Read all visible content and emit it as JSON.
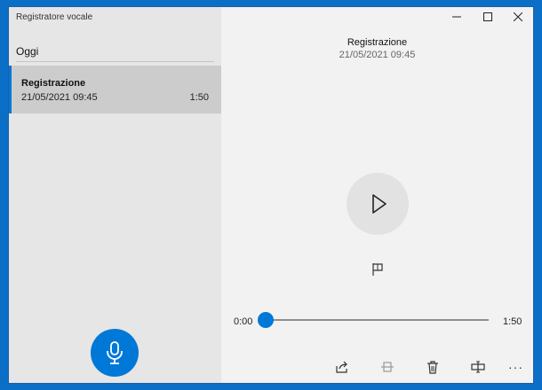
{
  "app": {
    "title": "Registratore vocale"
  },
  "list": {
    "section": "Oggi",
    "items": [
      {
        "name": "Registrazione",
        "date": "21/05/2021 09:45",
        "duration": "1:50"
      }
    ]
  },
  "detail": {
    "title": "Registrazione",
    "date": "21/05/2021 09:45"
  },
  "player": {
    "current_time": "0:00",
    "total_time": "1:50",
    "progress_fraction": 0.0
  },
  "toolbar": {
    "icons": [
      "share-icon",
      "trim-icon",
      "delete-icon",
      "rename-icon",
      "more-icon"
    ],
    "more_label": "···"
  },
  "colors": {
    "accent": "#0078d7",
    "desktop": "#0b6fc7"
  }
}
